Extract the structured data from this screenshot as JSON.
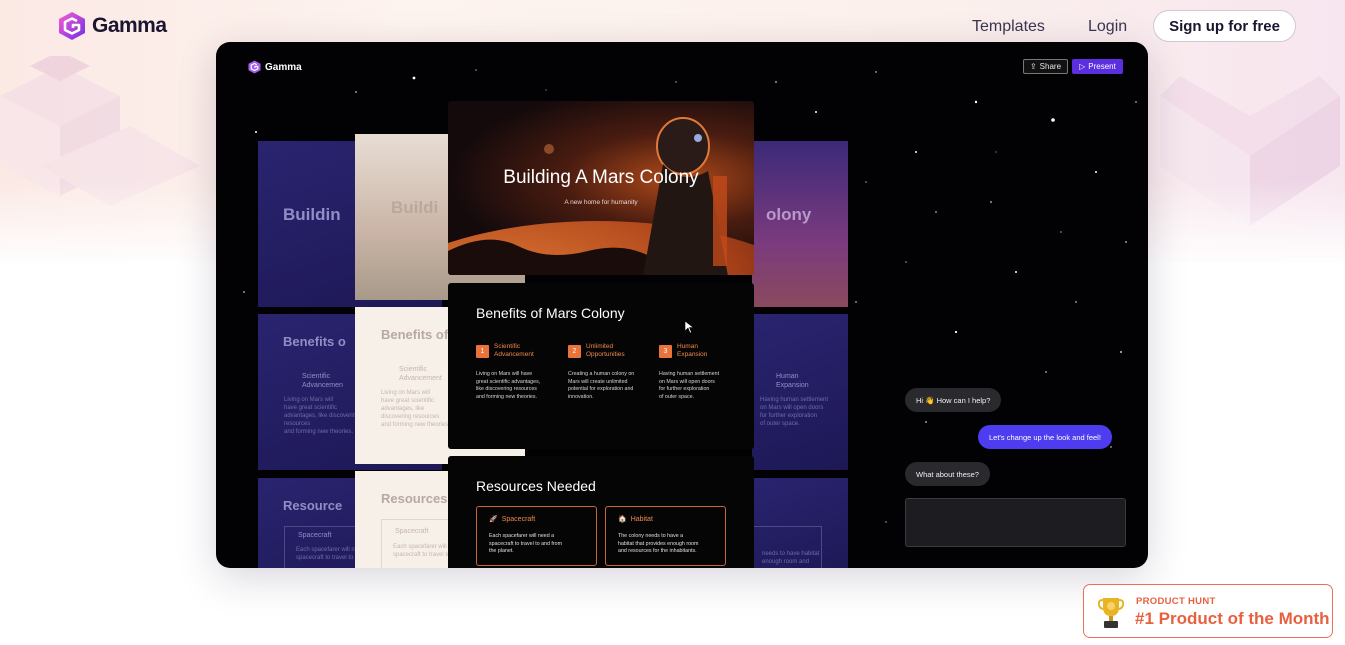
{
  "nav": {
    "brand": "Gamma",
    "links": [
      "Templates",
      "Login"
    ],
    "cta": "Sign up for free"
  },
  "demo": {
    "app_brand": "Gamma",
    "share_label": "Share",
    "present_label": "Present",
    "ghost_slides": {
      "left_titles": [
        "Buildin",
        "Benefits o",
        "Resource"
      ],
      "cream_titles": [
        "Buildi",
        "Benefits of",
        "Resources"
      ],
      "right_titles": [
        "olony"
      ],
      "left_benefit": "Scientific\nAdvancemen",
      "left_benefit_body": "Living on Mars will\nhave great scientific\nadvantages, like discovering\nresources\nand forming new theories.",
      "cream_benefit": "Scientific\nAdvancement",
      "cream_benefit_body": "Living on Mars will\nhave great scientific\nadvantages, like\ndiscovering resources\nand forming new theories.",
      "left_res": "Spacecraft",
      "left_res_body": "Each spacefarer will need a\nspacecraft to travel to",
      "cream_res": "Spacecraft",
      "cream_res_body": "Each spacefarer will n\nspacecraft to travel to",
      "right_benefit": "Human\nExpansion",
      "right_benefit_body": "Having human settlement\non Mars will open doors\nfor further exploration\nof outer space.",
      "right_res_body": "needs to have habitat\nenough room and"
    },
    "hero": {
      "title": "Building A Mars Colony",
      "subtitle": "A new home for humanity"
    },
    "benefits": {
      "title": "Benefits of Mars Colony",
      "items": [
        {
          "num": "1",
          "title": "Scientific\nAdvancement",
          "body": "Living on Mars will have\ngreat scientific advantages,\nlike discovering resources\nand forming new theories."
        },
        {
          "num": "2",
          "title": "Unlimited\nOpportunities",
          "body": "Creating a human colony on\nMars will create unlimited\npotential for exploration and\ninnovation."
        },
        {
          "num": "3",
          "title": "Human\nExpansion",
          "body": "Having human settlement\non Mars will open doors\nfor further exploration\nof outer space."
        }
      ]
    },
    "resources": {
      "title": "Resources Needed",
      "items": [
        {
          "title": "Spacecraft",
          "body": "Each spacefarer will need a\nspacecraft to travel to and from\nthe planet."
        },
        {
          "title": "Habitat",
          "body": "The colony needs to have a\nhabitat that provides enough room\nand resources for the inhabitants."
        }
      ]
    },
    "chat": {
      "assistant_1": "Hi 👋 How can I help?",
      "user_1": "Let's change up the look and feel!",
      "assistant_2": "What about these?",
      "input_value": ""
    }
  },
  "badge": {
    "eyebrow": "PRODUCT HUNT",
    "title": "#1 Product of the Month"
  },
  "colors": {
    "accent": "#5b2ee0",
    "orange": "#e9733a",
    "badge": "#e8603f"
  }
}
